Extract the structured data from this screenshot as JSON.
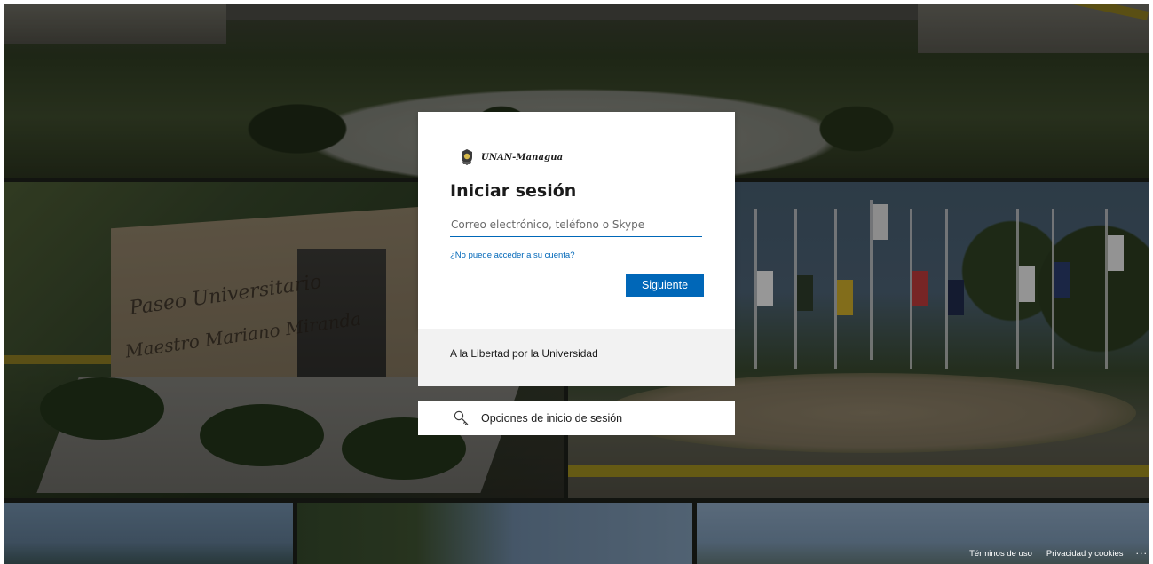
{
  "background": {
    "engraving_line1": "Paseo Universitario",
    "engraving_line2": "Maestro Mariano Miranda"
  },
  "brand": {
    "logo_icon": "unan-shield-logo",
    "name": "UNAN-Managua"
  },
  "signin": {
    "title": "Iniciar sesión",
    "email_placeholder": "Correo electrónico, teléfono o Skype",
    "email_value": "",
    "cant_access_link": "¿No puede acceder a su cuenta?",
    "next_button": "Siguiente"
  },
  "motto": "A la Libertad por la Universidad",
  "signin_options": {
    "icon": "key-search-icon",
    "label": "Opciones de inicio de sesión"
  },
  "footer": {
    "terms": "Términos de uso",
    "privacy": "Privacidad y cookies",
    "more": "···"
  },
  "colors": {
    "accent": "#0067b8",
    "card_bg": "#ffffff",
    "band_bg": "#f2f2f2"
  }
}
